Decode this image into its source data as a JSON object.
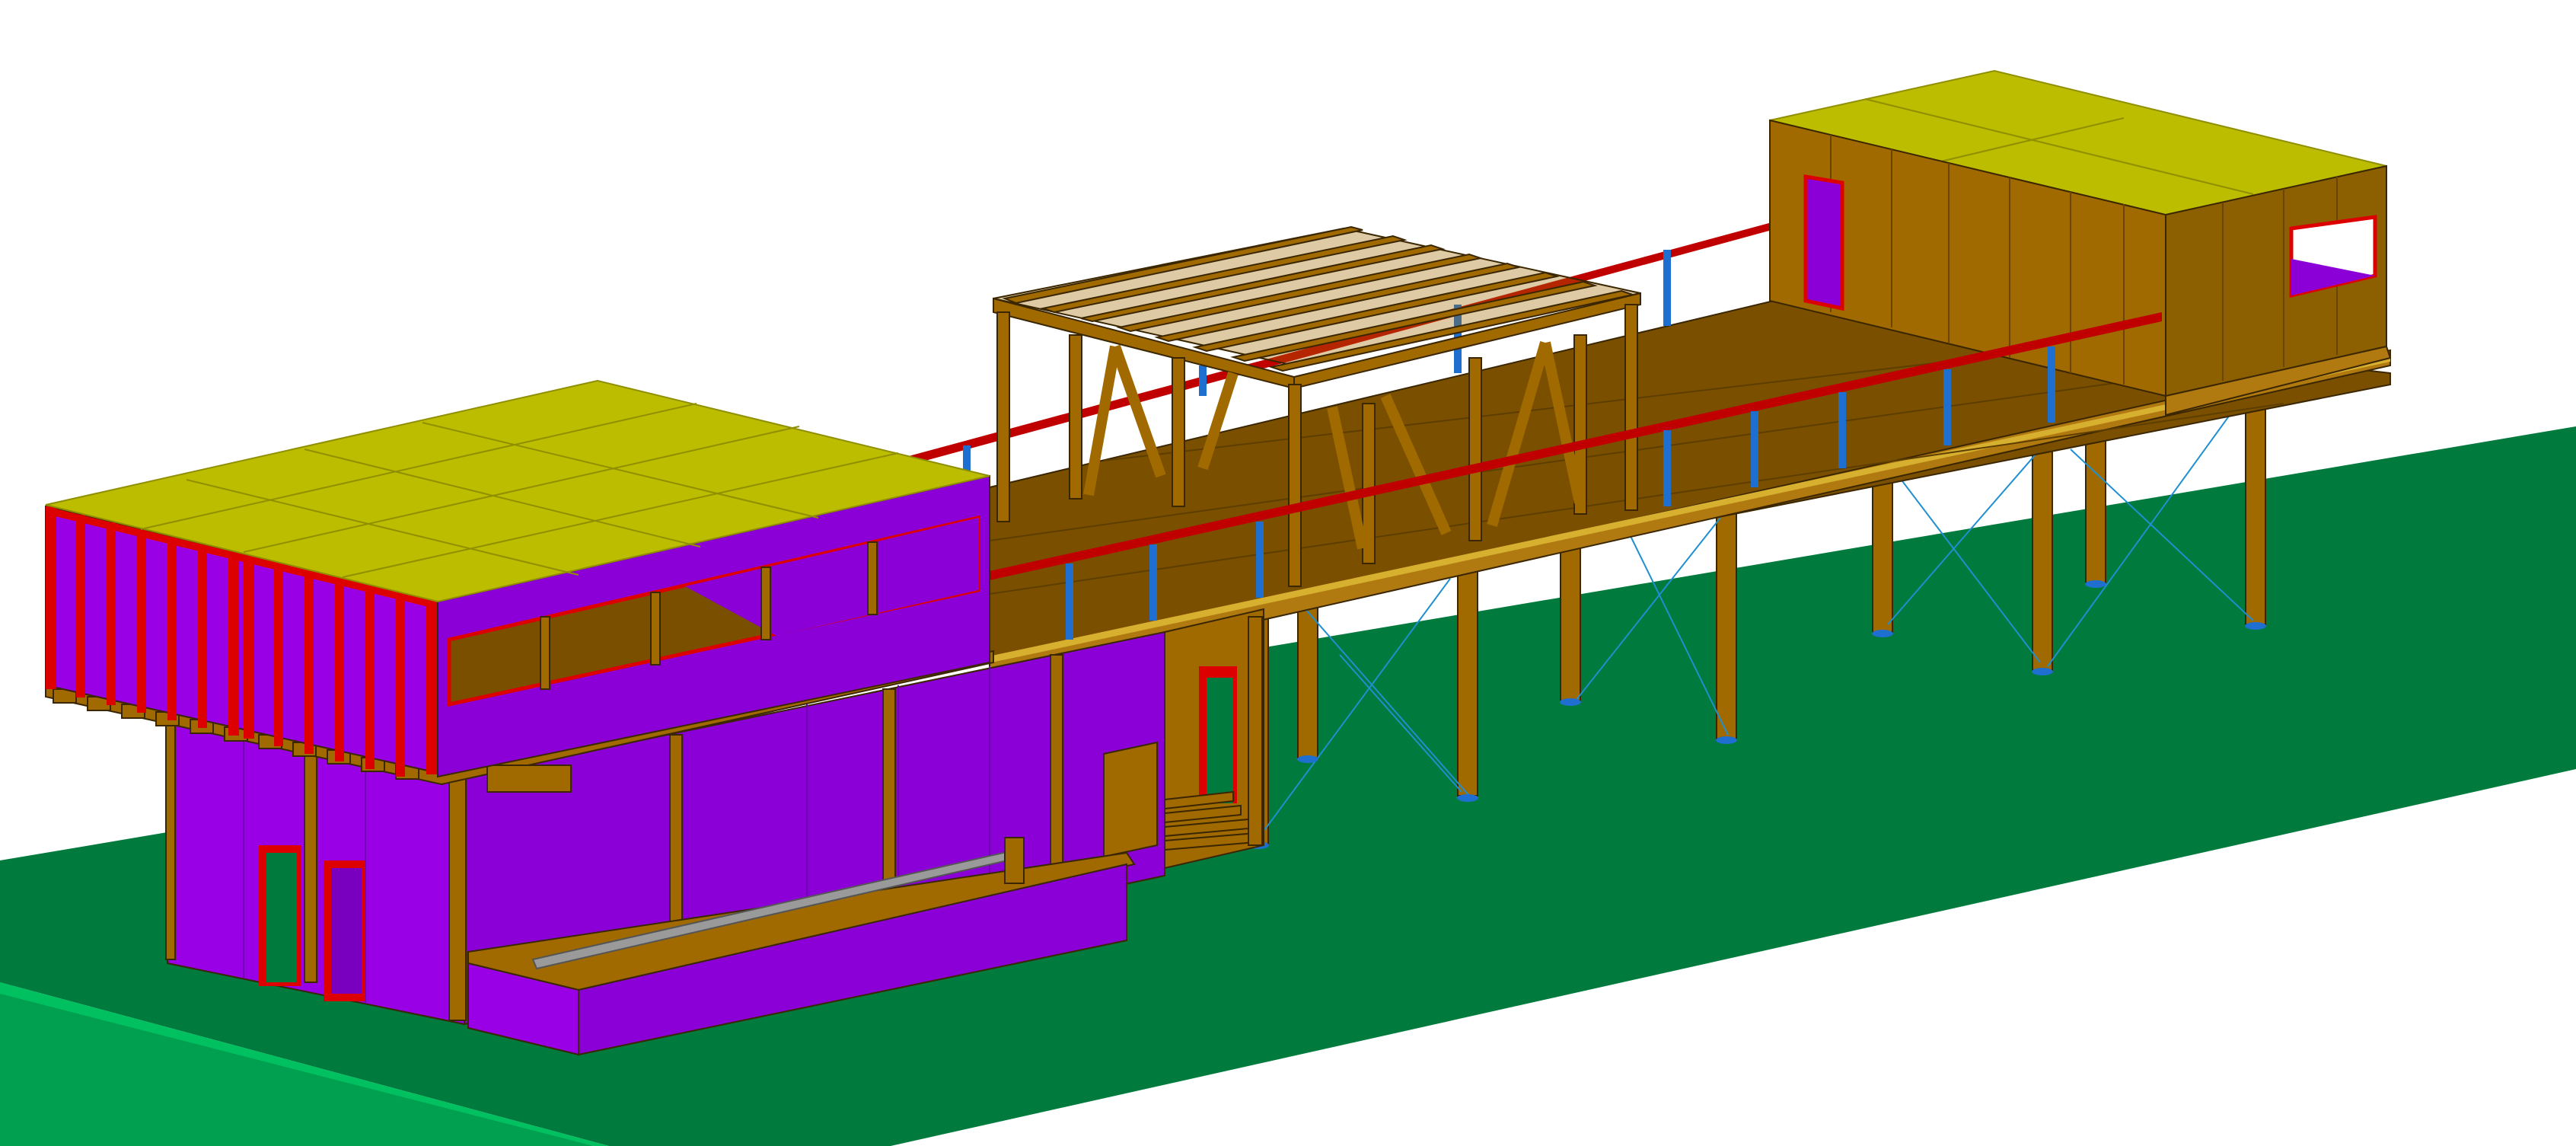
{
  "viewport": {
    "background": "#ffffff",
    "projection": "isometric"
  },
  "colors": {
    "ground": "#007a3d",
    "ground_edge": "#00a050",
    "roof": "#bdbd00",
    "roof_line": "#8f8f00",
    "wall_purple": "#8c00d8",
    "wall_purple_dark": "#6e00b0",
    "wood": "#a06a00",
    "wood_dark": "#7a5000",
    "wood_light": "#b07a10",
    "frame_red": "#dd0000",
    "steel_blue": "#1f6fd0",
    "slab_gray": "#9a9a9a",
    "outline": "#3a2600"
  },
  "model": {
    "objects": [
      "ground-plane",
      "left-building-roof",
      "left-building-upper-wall",
      "left-building-lower-wall",
      "pergola-frame",
      "deck-slab",
      "red-railing",
      "blue-posts",
      "right-cabin",
      "stilt-columns",
      "cross-bracing",
      "entrance-stair"
    ]
  }
}
